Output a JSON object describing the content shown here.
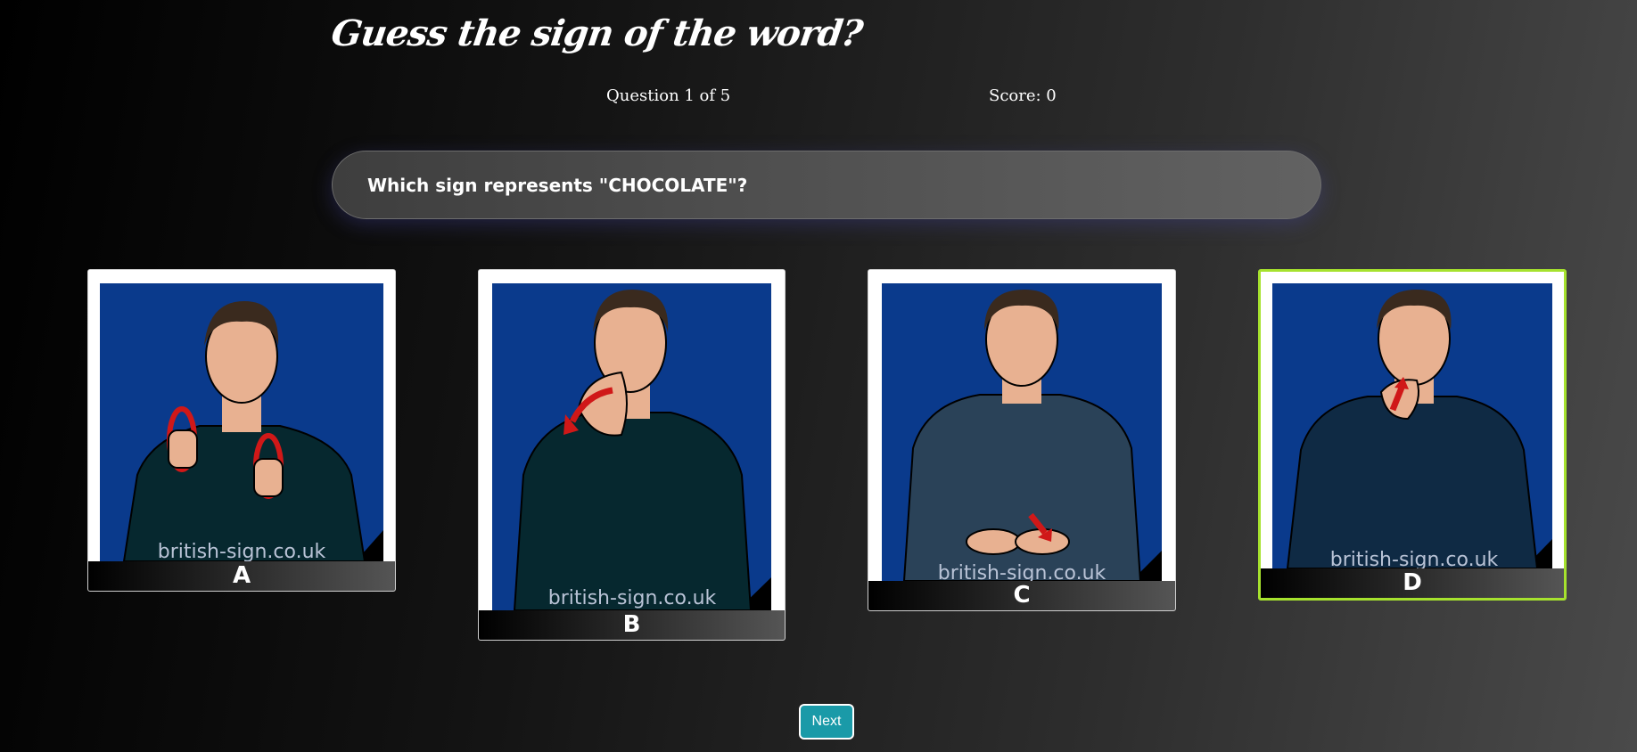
{
  "header": {
    "title": "Guess the sign of the word?",
    "question_progress": "Question 1 of 5",
    "score": "Score: 0"
  },
  "question": {
    "text": "Which sign represents \"CHOCOLATE\"?"
  },
  "options": [
    {
      "label": "A",
      "watermark": "british-sign.co.uk",
      "selected": false,
      "icon": "sign-image"
    },
    {
      "label": "B",
      "watermark": "british-sign.co.uk",
      "selected": false,
      "icon": "sign-image"
    },
    {
      "label": "C",
      "watermark": "british-sign.co.uk",
      "selected": false,
      "icon": "sign-image"
    },
    {
      "label": "D",
      "watermark": "british-sign.co.uk",
      "selected": true,
      "icon": "sign-image"
    }
  ],
  "actions": {
    "next_label": "Next"
  },
  "colors": {
    "selected_border": "#a6e22e",
    "next_button": "#1a9aa8",
    "card_background": "#0a3a8c"
  }
}
